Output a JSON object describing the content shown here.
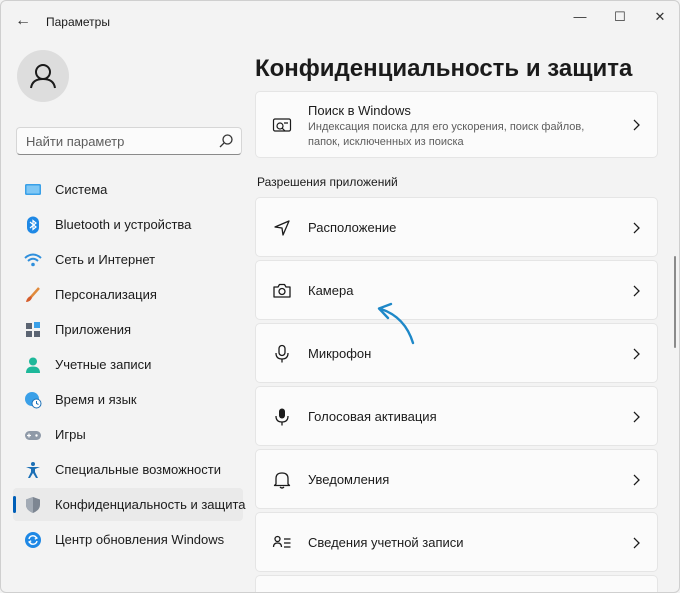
{
  "window": {
    "title": "Параметры",
    "controls": [
      "minimize-icon",
      "maximize-icon",
      "close-icon"
    ]
  },
  "search": {
    "placeholder": "Найти параметр"
  },
  "sidebar": {
    "items": [
      {
        "label": "Система",
        "icon": "system-icon"
      },
      {
        "label": "Bluetooth и устройства",
        "icon": "bluetooth-icon"
      },
      {
        "label": "Сеть и Интернет",
        "icon": "wifi-icon"
      },
      {
        "label": "Персонализация",
        "icon": "brush-icon"
      },
      {
        "label": "Приложения",
        "icon": "apps-icon"
      },
      {
        "label": "Учетные записи",
        "icon": "account-icon"
      },
      {
        "label": "Время и язык",
        "icon": "globe-clock-icon"
      },
      {
        "label": "Игры",
        "icon": "gamepad-icon"
      },
      {
        "label": "Специальные возможности",
        "icon": "accessibility-icon"
      },
      {
        "label": "Конфиденциальность и защита",
        "icon": "shield-icon",
        "active": true
      },
      {
        "label": "Центр обновления Windows",
        "icon": "update-icon"
      }
    ]
  },
  "main": {
    "title": "Конфиденциальность и защита",
    "search_card": {
      "title": "Поиск в Windows",
      "description": "Индексация поиска для его ускорения, поиск файлов, папок, исключенных из поиска"
    },
    "section_title": "Разрешения приложений",
    "items": [
      {
        "label": "Расположение",
        "icon": "location-icon"
      },
      {
        "label": "Камера",
        "icon": "camera-icon"
      },
      {
        "label": "Микрофон",
        "icon": "microphone-icon"
      },
      {
        "label": "Голосовая активация",
        "icon": "voice-activation-icon"
      },
      {
        "label": "Уведомления",
        "icon": "bell-icon"
      },
      {
        "label": "Сведения учетной записи",
        "icon": "account-info-icon"
      }
    ]
  },
  "colors": {
    "accent": "#005fb8",
    "annotation_arrow": "#1e88c8"
  }
}
